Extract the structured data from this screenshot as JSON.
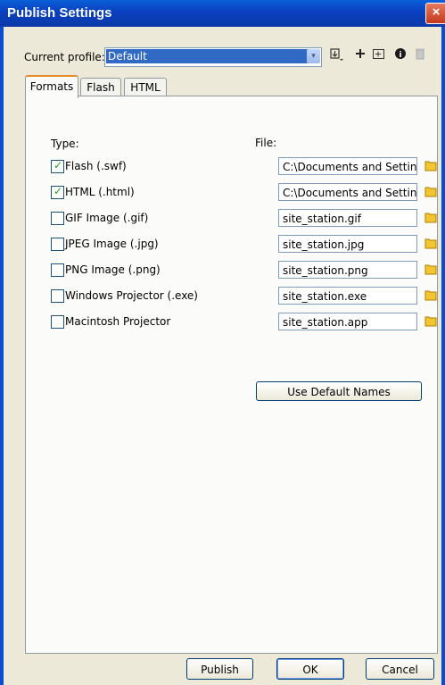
{
  "window": {
    "title": "Publish Settings",
    "close_glyph": "×"
  },
  "profile": {
    "label": "Current profile:",
    "value": "Default",
    "arrow_glyph": "▾",
    "toolbar_icons": [
      "import-export-icon",
      "add-profile-icon",
      "duplicate-profile-icon",
      "profile-info-icon",
      "delete-profile-icon"
    ]
  },
  "tabs": [
    "Formats",
    "Flash",
    "HTML"
  ],
  "headers": {
    "type": "Type:",
    "file": "File:"
  },
  "formats": [
    {
      "label": "Flash  (.swf)",
      "checked": true,
      "file": "C:\\Documents and Settings"
    },
    {
      "label": "HTML  (.html)",
      "checked": true,
      "file": "C:\\Documents and Settings"
    },
    {
      "label": "GIF Image  (.gif)",
      "checked": false,
      "file": "site_station.gif"
    },
    {
      "label": "JPEG Image  (.jpg)",
      "checked": false,
      "file": "site_station.jpg"
    },
    {
      "label": "PNG Image  (.png)",
      "checked": false,
      "file": "site_station.png"
    },
    {
      "label": "Windows Projector  (.exe)",
      "checked": false,
      "file": "site_station.exe"
    },
    {
      "label": "Macintosh Projector",
      "checked": false,
      "file": "site_station.app"
    }
  ],
  "use_default_names_label": "Use Default Names",
  "buttons": {
    "publish": "Publish",
    "ok": "OK",
    "cancel": "Cancel"
  },
  "colors": {
    "titlebar": "#0a4fd0",
    "selection": "#316ac5",
    "check": "#21a121",
    "folder": "#f2c531"
  }
}
